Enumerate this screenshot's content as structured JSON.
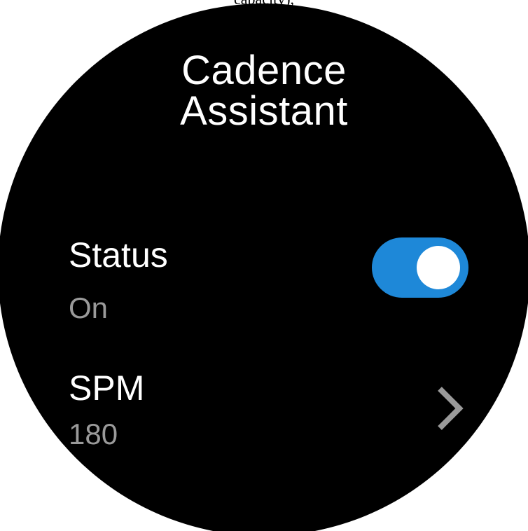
{
  "top_cut_text": "capacity),",
  "title": {
    "line1": "Cadence",
    "line2": "Assistant"
  },
  "status": {
    "label": "Status",
    "value": "On",
    "toggle_on": true
  },
  "spm": {
    "label": "SPM",
    "value": "180"
  },
  "colors": {
    "background": "#000000",
    "toggle_track": "#1e88d8",
    "secondary_text": "#9a9a9a",
    "chevron": "#9a9a9a"
  },
  "icons": {
    "spm_chevron": "chevron-right-icon"
  }
}
